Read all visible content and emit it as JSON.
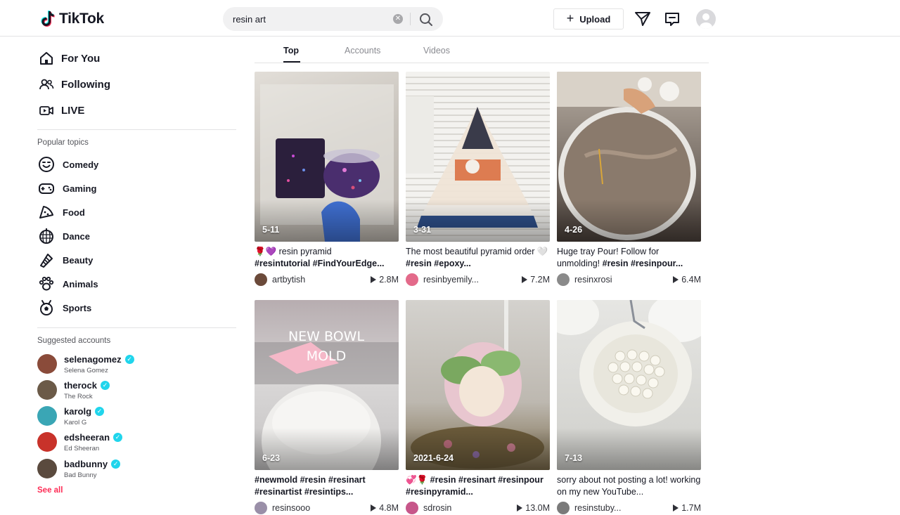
{
  "header": {
    "logo_text": "TikTok",
    "search_value": "resin art",
    "upload_label": "Upload",
    "icons": [
      "tiktok-logo-icon",
      "search-icon",
      "clear-icon",
      "plus-icon",
      "send-icon",
      "inbox-icon",
      "avatar"
    ]
  },
  "sidebar": {
    "nav": [
      {
        "label": "For You",
        "icon": "home-icon"
      },
      {
        "label": "Following",
        "icon": "people-icon"
      },
      {
        "label": "LIVE",
        "icon": "live-icon"
      }
    ],
    "popular_title": "Popular topics",
    "topics": [
      {
        "label": "Comedy",
        "icon": "comedy-icon"
      },
      {
        "label": "Gaming",
        "icon": "gaming-icon"
      },
      {
        "label": "Food",
        "icon": "food-icon"
      },
      {
        "label": "Dance",
        "icon": "dance-icon"
      },
      {
        "label": "Beauty",
        "icon": "beauty-icon"
      },
      {
        "label": "Animals",
        "icon": "animals-icon"
      },
      {
        "label": "Sports",
        "icon": "sports-icon"
      }
    ],
    "suggested_title": "Suggested accounts",
    "accounts": [
      {
        "username": "selenagomez",
        "name": "Selena Gomez",
        "color": "#8a4b3a"
      },
      {
        "username": "therock",
        "name": "The Rock",
        "color": "#6b5a48"
      },
      {
        "username": "karolg",
        "name": "Karol G",
        "color": "#3aa6b5"
      },
      {
        "username": "edsheeran",
        "name": "Ed Sheeran",
        "color": "#c8322a"
      },
      {
        "username": "badbunny",
        "name": "Bad Bunny",
        "color": "#5a4a3e"
      }
    ],
    "see_all": "See all"
  },
  "tabs": [
    {
      "label": "Top",
      "active": true
    },
    {
      "label": "Accounts",
      "active": false
    },
    {
      "label": "Videos",
      "active": false
    }
  ],
  "videos": [
    {
      "date": "5-11",
      "desc_plain": "🌹💜 resin pyramid",
      "desc_tags": "#resintutorial #FindYourEdge...",
      "creator": "artbytish",
      "views": "2.8M",
      "thumb_colors": [
        "#cfcbc4",
        "#4a2a5e",
        "#2b2840"
      ],
      "avatar_color": "#6b4a3a"
    },
    {
      "date": "3-31",
      "desc_plain": "The most beautiful pyramid order 🤍",
      "desc_tags": "#resin #epoxy...",
      "creator": "resinbyemily...",
      "views": "7.2M",
      "thumb_colors": [
        "#e8e6e2",
        "#d9a27a",
        "#3a5a8a"
      ],
      "avatar_color": "#e36a8a"
    },
    {
      "date": "4-26",
      "desc_plain": "Huge tray Pour! Follow for unmolding!",
      "desc_tags": "#resin #resinpour...",
      "creator": "resinxrosi",
      "views": "6.4M",
      "thumb_colors": [
        "#d8d0c5",
        "#7a6a5c",
        "#3a3430"
      ],
      "avatar_color": "#8a8a8a"
    },
    {
      "date": "6-23",
      "desc_plain": "",
      "desc_tags": "#newmold #resin #resinart #resinartist #resintips...",
      "creator": "resinsooo",
      "views": "4.8M",
      "thumb_colors": [
        "#c9c4c6",
        "#e6e6e6",
        "#b8b3b5"
      ],
      "avatar_color": "#9a8fa8",
      "overlay_text": "NEW BOWL MOLD"
    },
    {
      "date": "2021-6-24",
      "desc_plain": "💞🌹",
      "desc_tags": "#resin #resinart #resinpour #resinpyramid...",
      "creator": "sdrosin",
      "views": "13.0M",
      "thumb_colors": [
        "#c4c2bd",
        "#d89aa8",
        "#6a5a3a"
      ],
      "avatar_color": "#c7568a"
    },
    {
      "date": "7-13",
      "desc_plain": "sorry about not posting a lot! working on my new YouTube...",
      "desc_tags": "",
      "creator": "resinstuby...",
      "views": "1.7M",
      "thumb_colors": [
        "#dcdcd9",
        "#ecebe4",
        "#a9a9a5"
      ],
      "avatar_color": "#7a7a7a"
    }
  ]
}
